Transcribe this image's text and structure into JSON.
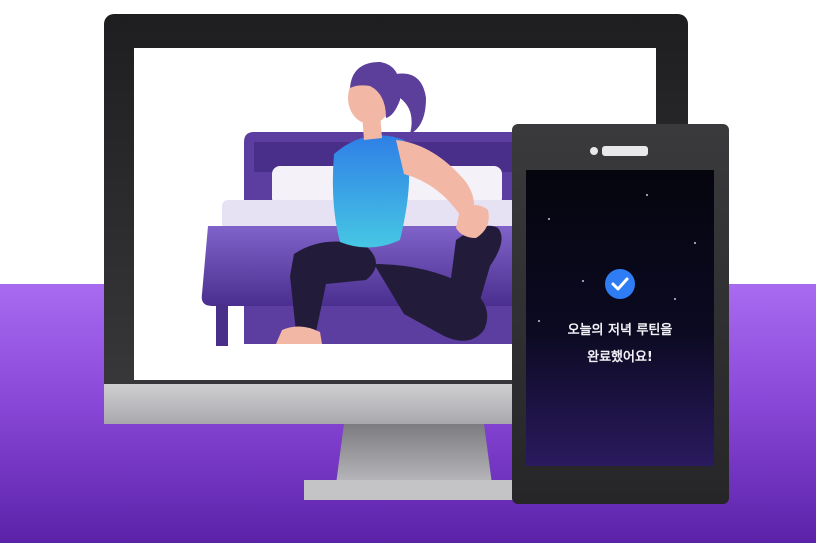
{
  "phone": {
    "message_line1": "오늘의 저녁 루틴을",
    "message_line2": "완료했어요!",
    "check_icon": "check-circle-icon"
  },
  "colors": {
    "band": "#8a48d8",
    "monitor_frame": "#2b2b2d",
    "bed": "#5e3fa3",
    "shirt": "#3db6e6",
    "pants": "#221c3a",
    "hair": "#5b3f9a",
    "check": "#2f7df5"
  }
}
